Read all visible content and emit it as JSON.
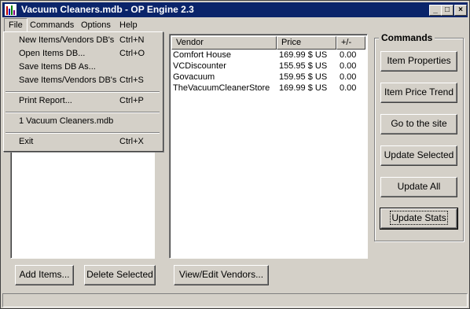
{
  "window": {
    "title": "Vacuum Cleaners.mdb - OP Engine  2.3",
    "minimize_glyph": "_",
    "maximize_glyph": "□",
    "close_glyph": "×"
  },
  "menubar": {
    "items": [
      {
        "label": "File"
      },
      {
        "label": "Commands"
      },
      {
        "label": "Options"
      },
      {
        "label": "Help"
      }
    ]
  },
  "file_menu": {
    "items": [
      {
        "label": "New Items/Vendors DB's",
        "shortcut": "Ctrl+N"
      },
      {
        "label": "Open Items DB...",
        "shortcut": "Ctrl+O"
      },
      {
        "label": "Save Items DB As...",
        "shortcut": ""
      },
      {
        "label": "Save Items/Vendors DB's",
        "shortcut": "Ctrl+S"
      },
      {
        "label": "Print Report...",
        "shortcut": "Ctrl+P"
      },
      {
        "label": "1  Vacuum Cleaners.mdb",
        "shortcut": ""
      },
      {
        "label": "Exit",
        "shortcut": "Ctrl+X"
      }
    ]
  },
  "vendors_table": {
    "columns": [
      "Vendor",
      "Price",
      "+/-"
    ],
    "rows": [
      {
        "vendor": "Comfort House",
        "price": "169.99 $ US",
        "change": "0.00"
      },
      {
        "vendor": "VCDiscounter",
        "price": "155.95 $ US",
        "change": "0.00"
      },
      {
        "vendor": "Govacuum",
        "price": "159.95 $ US",
        "change": "0.00"
      },
      {
        "vendor": "TheVacuumCleanerStore",
        "price": "169.99 $ US",
        "change": "0.00"
      }
    ]
  },
  "commands": {
    "group_label": "Commands",
    "buttons": [
      {
        "label": "Item Properties"
      },
      {
        "label": "Item Price Trend"
      },
      {
        "label": "Go to the site"
      },
      {
        "label": "Update Selected"
      },
      {
        "label": "Update All"
      },
      {
        "label": "Update Stats"
      }
    ]
  },
  "bottom_buttons": {
    "add_items": "Add Items...",
    "delete_selected": "Delete Selected",
    "view_edit_vendors": "View/Edit Vendors..."
  },
  "colors": {
    "titlebar": "#0a246a",
    "face": "#d4d0c8"
  }
}
